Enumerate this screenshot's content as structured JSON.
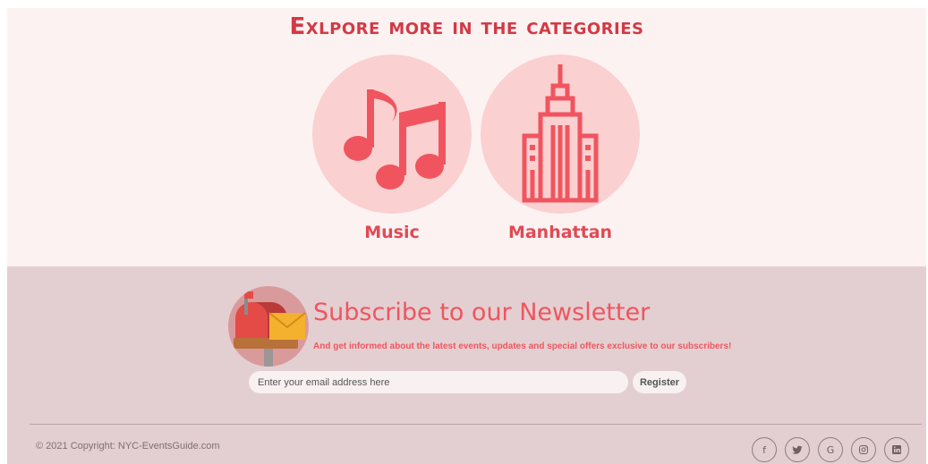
{
  "categories": {
    "title": "Exlpore more in the categories",
    "items": [
      {
        "label": "Music",
        "icon": "music-notes-icon"
      },
      {
        "label": "Manhattan",
        "icon": "empire-state-building-icon"
      }
    ]
  },
  "newsletter": {
    "title": "Subscribe to our Newsletter",
    "subtitle": "And get informed about the latest events, updates and special offers exclusive to our subscribers!",
    "email_placeholder": "Enter your email address here",
    "register_label": "Register",
    "icon": "mailbox-icon"
  },
  "footer": {
    "copyright": "© 2021 Copyright: NYC-EventsGuide.com",
    "social": [
      {
        "name": "facebook",
        "glyph": "f"
      },
      {
        "name": "twitter",
        "glyph": "🐦"
      },
      {
        "name": "google",
        "glyph": "G"
      },
      {
        "name": "instagram",
        "glyph": "◎"
      },
      {
        "name": "linkedin",
        "glyph": "in"
      }
    ]
  },
  "colors": {
    "accent": "#e04a55",
    "category_bg": "#fdf2f2",
    "circle_bg": "#fbd0d0",
    "newsletter_bg": "#e3cfd1"
  }
}
